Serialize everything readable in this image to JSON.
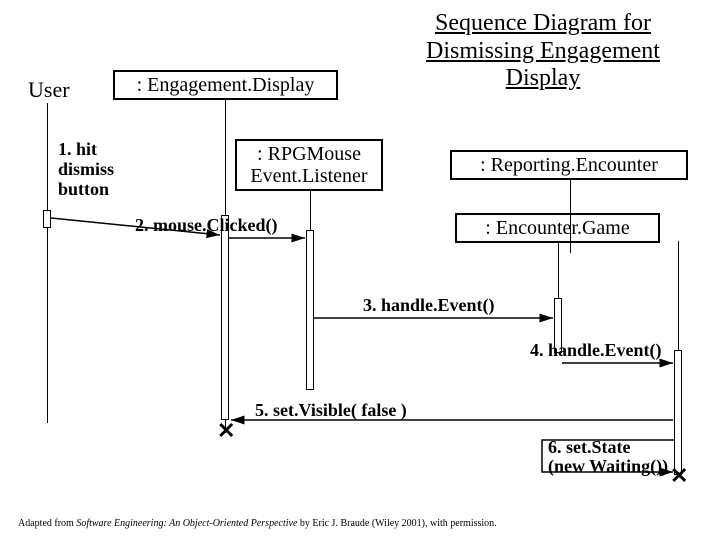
{
  "title_line1": "Sequence Diagram for",
  "title_line2": "Dismissing Engagement",
  "title_line3": "Display",
  "actor": "User",
  "objects": {
    "engagement": ": Engagement.Display",
    "rpgmouse_l1": ": RPGMouse",
    "rpgmouse_l2": "Event.Listener",
    "reporting": ": Reporting.Encounter",
    "encounter": ": Encounter.Game"
  },
  "note_line1": "1. hit",
  "note_line2": "dismiss",
  "note_line3": "button",
  "messages": {
    "m2": "2. mouse.Clicked()",
    "m3": "3. handle.Event()",
    "m4": "4. handle.Event()",
    "m5": "5. set.Visible( false )",
    "m6_l1": "6. set.State",
    "m6_l2": "(new Waiting())"
  },
  "credit_pre": "Adapted from ",
  "credit_ital": "Software Engineering: An Object-Oriented Perspective",
  "credit_post": " by Eric J. Braude (Wiley 2001), with permission."
}
